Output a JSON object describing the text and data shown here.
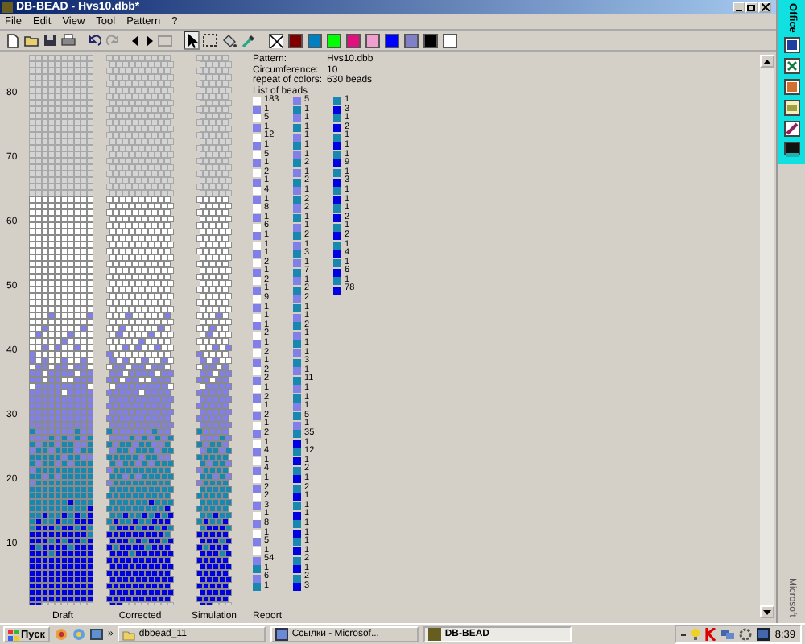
{
  "window": {
    "title": "DB-BEAD - Hvs10.dbb*"
  },
  "menu": [
    "File",
    "Edit",
    "View",
    "Tool",
    "Pattern",
    "?"
  ],
  "palette": [
    {
      "kind": "none"
    },
    {
      "kind": "swatch",
      "color": "#800000"
    },
    {
      "kind": "swatch",
      "color": "#0080c0"
    },
    {
      "kind": "swatch",
      "color": "#00ff00"
    },
    {
      "kind": "swatch",
      "color": "#e0107f"
    },
    {
      "kind": "swatch",
      "color": "#f0a0d0"
    },
    {
      "kind": "swatch",
      "color": "#0000ff"
    },
    {
      "kind": "swatch",
      "color": "#8080c8"
    },
    {
      "kind": "swatch",
      "color": "#000000"
    },
    {
      "kind": "swatch",
      "color": "#ffffff"
    }
  ],
  "axis_labels": [
    "80",
    "70",
    "60",
    "50",
    "40",
    "30",
    "20",
    "10"
  ],
  "panels": [
    {
      "kind": "draft",
      "label": "Draft"
    },
    {
      "kind": "corrected",
      "label": "Corrected"
    },
    {
      "kind": "simulation",
      "label": "Simulation"
    }
  ],
  "report": {
    "label": "Report",
    "info": [
      {
        "key": "Pattern:",
        "value": "Hvs10.dbb"
      },
      {
        "key": "Circumference:",
        "value": "10"
      },
      {
        "key": "repeat of colors:",
        "value": "630 beads"
      }
    ],
    "list_title": "List of beads",
    "columns": [
      [
        {
          "color": "#ffffff",
          "count": "183"
        },
        {
          "color": "#8080e8",
          "count": "1"
        },
        {
          "color": "#ffffff",
          "count": "5"
        },
        {
          "color": "#8080e8",
          "count": "1"
        },
        {
          "color": "#ffffff",
          "count": "12"
        },
        {
          "color": "#8080e8",
          "count": "1"
        },
        {
          "color": "#ffffff",
          "count": "5"
        },
        {
          "color": "#8080e8",
          "count": "1"
        },
        {
          "color": "#ffffff",
          "count": "2"
        },
        {
          "color": "#8080e8",
          "count": "1"
        },
        {
          "color": "#ffffff",
          "count": "4"
        },
        {
          "color": "#8080e8",
          "count": "1"
        },
        {
          "color": "#ffffff",
          "count": "8"
        },
        {
          "color": "#8080e8",
          "count": "1"
        },
        {
          "color": "#ffffff",
          "count": "6"
        },
        {
          "color": "#8080e8",
          "count": "1"
        },
        {
          "color": "#ffffff",
          "count": "1"
        },
        {
          "color": "#8080e8",
          "count": "1"
        },
        {
          "color": "#ffffff",
          "count": "2"
        },
        {
          "color": "#8080e8",
          "count": "1"
        },
        {
          "color": "#ffffff",
          "count": "2"
        },
        {
          "color": "#8080e8",
          "count": "1"
        },
        {
          "color": "#ffffff",
          "count": "9"
        },
        {
          "color": "#8080e8",
          "count": "1"
        },
        {
          "color": "#ffffff",
          "count": "1"
        },
        {
          "color": "#8080e8",
          "count": "1"
        },
        {
          "color": "#ffffff",
          "count": "2"
        },
        {
          "color": "#8080e8",
          "count": "1"
        },
        {
          "color": "#ffffff",
          "count": "2"
        },
        {
          "color": "#8080e8",
          "count": "1"
        },
        {
          "color": "#ffffff",
          "count": "2"
        },
        {
          "color": "#8080e8",
          "count": "2"
        },
        {
          "color": "#ffffff",
          "count": "1"
        },
        {
          "color": "#8080e8",
          "count": "2"
        },
        {
          "color": "#ffffff",
          "count": "1"
        },
        {
          "color": "#8080e8",
          "count": "2"
        },
        {
          "color": "#ffffff",
          "count": "1"
        },
        {
          "color": "#8080e8",
          "count": "2"
        },
        {
          "color": "#ffffff",
          "count": "1"
        },
        {
          "color": "#8080e8",
          "count": "4"
        },
        {
          "color": "#ffffff",
          "count": "1"
        },
        {
          "color": "#8080e8",
          "count": "4"
        },
        {
          "color": "#ffffff",
          "count": "1"
        },
        {
          "color": "#8080e8",
          "count": "2"
        },
        {
          "color": "#ffffff",
          "count": "2"
        },
        {
          "color": "#8080e8",
          "count": "3"
        },
        {
          "color": "#ffffff",
          "count": "1"
        },
        {
          "color": "#8080e8",
          "count": "8"
        },
        {
          "color": "#ffffff",
          "count": "1"
        },
        {
          "color": "#8080e8",
          "count": "5"
        },
        {
          "color": "#ffffff",
          "count": "1"
        },
        {
          "color": "#8080e8",
          "count": "54"
        },
        {
          "color": "#1888b0",
          "count": "1"
        },
        {
          "color": "#8080e8",
          "count": "6"
        },
        {
          "color": "#1888b0",
          "count": "1"
        }
      ],
      [
        {
          "color": "#8080e8",
          "count": "5"
        },
        {
          "color": "#1888b0",
          "count": "1"
        },
        {
          "color": "#8080e8",
          "count": "1"
        },
        {
          "color": "#1888b0",
          "count": "1"
        },
        {
          "color": "#8080e8",
          "count": "1"
        },
        {
          "color": "#1888b0",
          "count": "1"
        },
        {
          "color": "#8080e8",
          "count": "1"
        },
        {
          "color": "#1888b0",
          "count": "2"
        },
        {
          "color": "#8080e8",
          "count": "1"
        },
        {
          "color": "#1888b0",
          "count": "2"
        },
        {
          "color": "#8080e8",
          "count": "1"
        },
        {
          "color": "#1888b0",
          "count": "2"
        },
        {
          "color": "#8080e8",
          "count": "2"
        },
        {
          "color": "#1888b0",
          "count": "1"
        },
        {
          "color": "#8080e8",
          "count": "1"
        },
        {
          "color": "#1888b0",
          "count": "2"
        },
        {
          "color": "#8080e8",
          "count": "1"
        },
        {
          "color": "#1888b0",
          "count": "3"
        },
        {
          "color": "#8080e8",
          "count": "1"
        },
        {
          "color": "#1888b0",
          "count": "7"
        },
        {
          "color": "#8080e8",
          "count": "1"
        },
        {
          "color": "#1888b0",
          "count": "2"
        },
        {
          "color": "#8080e8",
          "count": "2"
        },
        {
          "color": "#1888b0",
          "count": "1"
        },
        {
          "color": "#8080e8",
          "count": "1"
        },
        {
          "color": "#1888b0",
          "count": "2"
        },
        {
          "color": "#8080e8",
          "count": "1"
        },
        {
          "color": "#1888b0",
          "count": "1"
        },
        {
          "color": "#8080e8",
          "count": "1"
        },
        {
          "color": "#1888b0",
          "count": "3"
        },
        {
          "color": "#8080e8",
          "count": "1"
        },
        {
          "color": "#1888b0",
          "count": "11"
        },
        {
          "color": "#8080e8",
          "count": "1"
        },
        {
          "color": "#1888b0",
          "count": "1"
        },
        {
          "color": "#8080e8",
          "count": "1"
        },
        {
          "color": "#1888b0",
          "count": "5"
        },
        {
          "color": "#8080e8",
          "count": "1"
        },
        {
          "color": "#1888b0",
          "count": "35"
        },
        {
          "color": "#0000e0",
          "count": "1"
        },
        {
          "color": "#1888b0",
          "count": "12"
        },
        {
          "color": "#0000e0",
          "count": "1"
        },
        {
          "color": "#1888b0",
          "count": "2"
        },
        {
          "color": "#0000e0",
          "count": "1"
        },
        {
          "color": "#1888b0",
          "count": "2"
        },
        {
          "color": "#0000e0",
          "count": "1"
        },
        {
          "color": "#1888b0",
          "count": "1"
        },
        {
          "color": "#0000e0",
          "count": "1"
        },
        {
          "color": "#1888b0",
          "count": "1"
        },
        {
          "color": "#0000e0",
          "count": "1"
        },
        {
          "color": "#1888b0",
          "count": "1"
        },
        {
          "color": "#0000e0",
          "count": "1"
        },
        {
          "color": "#1888b0",
          "count": "2"
        },
        {
          "color": "#0000e0",
          "count": "1"
        },
        {
          "color": "#1888b0",
          "count": "2"
        },
        {
          "color": "#0000e0",
          "count": "3"
        }
      ],
      [
        {
          "color": "#1888b0",
          "count": "1"
        },
        {
          "color": "#0000e0",
          "count": "3"
        },
        {
          "color": "#1888b0",
          "count": "1"
        },
        {
          "color": "#0000e0",
          "count": "2"
        },
        {
          "color": "#1888b0",
          "count": "1"
        },
        {
          "color": "#0000e0",
          "count": "1"
        },
        {
          "color": "#1888b0",
          "count": "1"
        },
        {
          "color": "#0000e0",
          "count": "9"
        },
        {
          "color": "#1888b0",
          "count": "1"
        },
        {
          "color": "#0000e0",
          "count": "3"
        },
        {
          "color": "#1888b0",
          "count": "1"
        },
        {
          "color": "#0000e0",
          "count": "1"
        },
        {
          "color": "#1888b0",
          "count": "1"
        },
        {
          "color": "#0000e0",
          "count": "2"
        },
        {
          "color": "#1888b0",
          "count": "1"
        },
        {
          "color": "#0000e0",
          "count": "2"
        },
        {
          "color": "#1888b0",
          "count": "1"
        },
        {
          "color": "#0000e0",
          "count": "4"
        },
        {
          "color": "#1888b0",
          "count": "1"
        },
        {
          "color": "#0000e0",
          "count": "6"
        },
        {
          "color": "#1888b0",
          "count": "1"
        },
        {
          "color": "#0000e0",
          "count": "78"
        }
      ]
    ]
  },
  "office_bar": {
    "title": "Office",
    "footer": "Microsoft"
  },
  "taskbar": {
    "start": "Пуск",
    "chevron": "»",
    "tasks": [
      {
        "label": "dbbead_11",
        "selected": false
      },
      {
        "label": "Ссылки - Microsof...",
        "selected": false
      },
      {
        "label": "DB-BEAD",
        "selected": true
      }
    ],
    "clock": "8:39"
  }
}
